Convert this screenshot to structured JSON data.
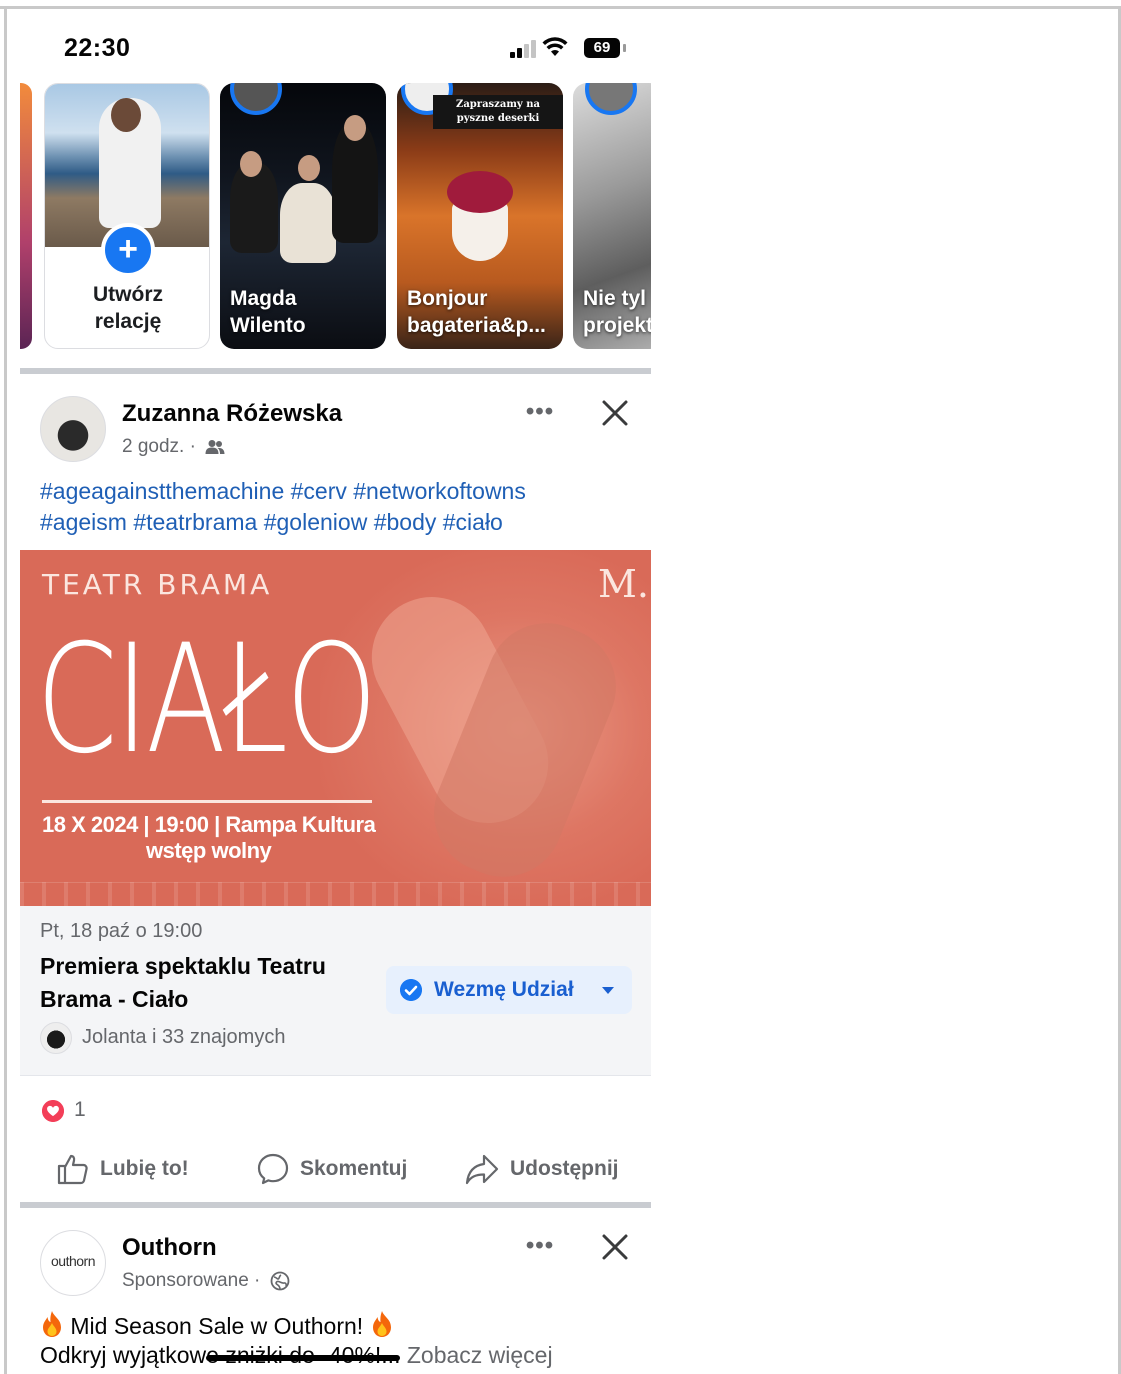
{
  "status_bar": {
    "time": "22:30",
    "battery": "69"
  },
  "stories": {
    "create": {
      "label_line1": "Utwórz",
      "label_line2": "relację"
    },
    "items": [
      {
        "name_line1": "Magda",
        "name_line2": "Wilento"
      },
      {
        "name_line1": "Bonjour",
        "name_line2": "bagateria&p...",
        "overlay_line1": "Zapraszamy na",
        "overlay_line2": "pyszne deserki"
      },
      {
        "name_line1": "Nie tyl",
        "name_line2": "projekt"
      }
    ]
  },
  "post": {
    "author": "Zuzanna Różewska",
    "time": "2 godz.",
    "audience_icon": "friends-icon",
    "more_label": "•••",
    "hashtags_line1": "#ageagainstthemachine #cerv #networkoftowns",
    "hashtags_line2": "#ageism #teatrbrama #goleniow #body #ciało",
    "image": {
      "theatre": "TEATR BRAMA",
      "logo": "M.",
      "title": "CIAŁO",
      "info": "18 X 2024 | 19:00 | Rampa Kultura",
      "entry": "wstęp wolny"
    },
    "event": {
      "date": "Pt, 18 paź o 19:00",
      "title": "Premiera spektaklu Teatru Brama - Ciało",
      "rsvp_label": "Wezmę Udział",
      "friends": "Jolanta i 33 znajomych"
    },
    "reactions": {
      "count": "1"
    },
    "actions": {
      "like": "Lubię to!",
      "comment": "Skomentuj",
      "share": "Udostępnij"
    }
  },
  "sponsored": {
    "logo_text": "outhorn",
    "name": "Outhorn",
    "meta": "Sponsorowane",
    "more_label": "•••",
    "text_line1": "Mid Season Sale w Outhorn!",
    "text_line2_start": "Odkryj wyjątkow",
    "text_line2_struck": "e zniżki do -40%!...",
    "see_more": "Zobacz więcej"
  },
  "colors": {
    "accent": "#1877f2",
    "event_bg": "#d96a58",
    "hashtag": "#1f5fb5",
    "heart": "#f33e58"
  }
}
